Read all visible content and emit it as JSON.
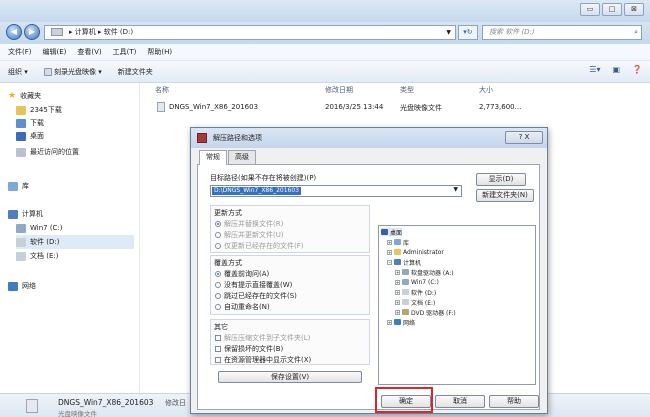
{
  "window": {
    "buttons": {
      "min": "▭",
      "max": "□",
      "close": "⊠"
    }
  },
  "address": {
    "path": "▸ 计算机 ▸ 软件 (D:)",
    "search_placeholder": "搜索 软件 (D:)"
  },
  "menu": [
    "文件(F)",
    "编辑(E)",
    "查看(V)",
    "工具(T)",
    "帮助(H)"
  ],
  "toolbar": {
    "organize": "组织 ▾",
    "burn": "刻录光盘映像 ▾",
    "new_folder": "新建文件夹"
  },
  "nav": {
    "favorites": "收藏夹",
    "fav_items": [
      "2345下载",
      "下载",
      "桌面",
      "最近访问的位置"
    ],
    "library": "库",
    "computer": "计算机",
    "drives": [
      "Win7 (C:)",
      "软件 (D:)",
      "文档 (E:)"
    ],
    "network": "网络"
  },
  "columns": {
    "name": "名称",
    "date": "修改日期",
    "type": "类型",
    "size": "大小"
  },
  "files": [
    {
      "name": "DNGS_Win7_X86_201603",
      "date": "2016/3/25 13:44",
      "type": "光盘映像文件",
      "size": "2,773,600..."
    }
  ],
  "details": {
    "name": "DNGS_Win7_X86_201603",
    "date_label": "修改日",
    "type": "光盘映像文件"
  },
  "dialog": {
    "title": "解压路径和选项",
    "close": "?  X",
    "tabs": [
      "常规",
      "高级"
    ],
    "dest_label": "目标路径(如果不存在将被创建)(P)",
    "dest_value": "D:\\DNGS_Win7_X86_201603",
    "show_button": "显示(D)",
    "newfolder_button": "新建文件夹(N)",
    "update_label": "更新方式",
    "update_opts": [
      "解压并替换文件(R)",
      "解压并更新文件(U)",
      "仅更新已经存在的文件(F)"
    ],
    "overwrite_label": "覆盖方式",
    "overwrite_opts": [
      "覆盖前询问(A)",
      "没有提示直接覆盖(W)",
      "跳过已经存在的文件(S)",
      "自动重命名(N)"
    ],
    "misc_label": "其它",
    "misc_opts": [
      "解压压缩文件到子文件夹(L)",
      "保留损坏的文件(B)",
      "在资源管理器中显示文件(X)"
    ],
    "save_button": "保存设置(V)",
    "tree": {
      "desktop": "桌面",
      "library": "库",
      "admin": "Administrator",
      "computer": "计算机",
      "floppy": "软盘驱动器 (A:)",
      "c": "Win7 (C:)",
      "d": "软件 (D:)",
      "e": "文档 (E:)",
      "dvd": "DVD 驱动器 (F:)",
      "network": "网络"
    },
    "ok": "确定",
    "cancel": "取消",
    "help": "帮助"
  }
}
